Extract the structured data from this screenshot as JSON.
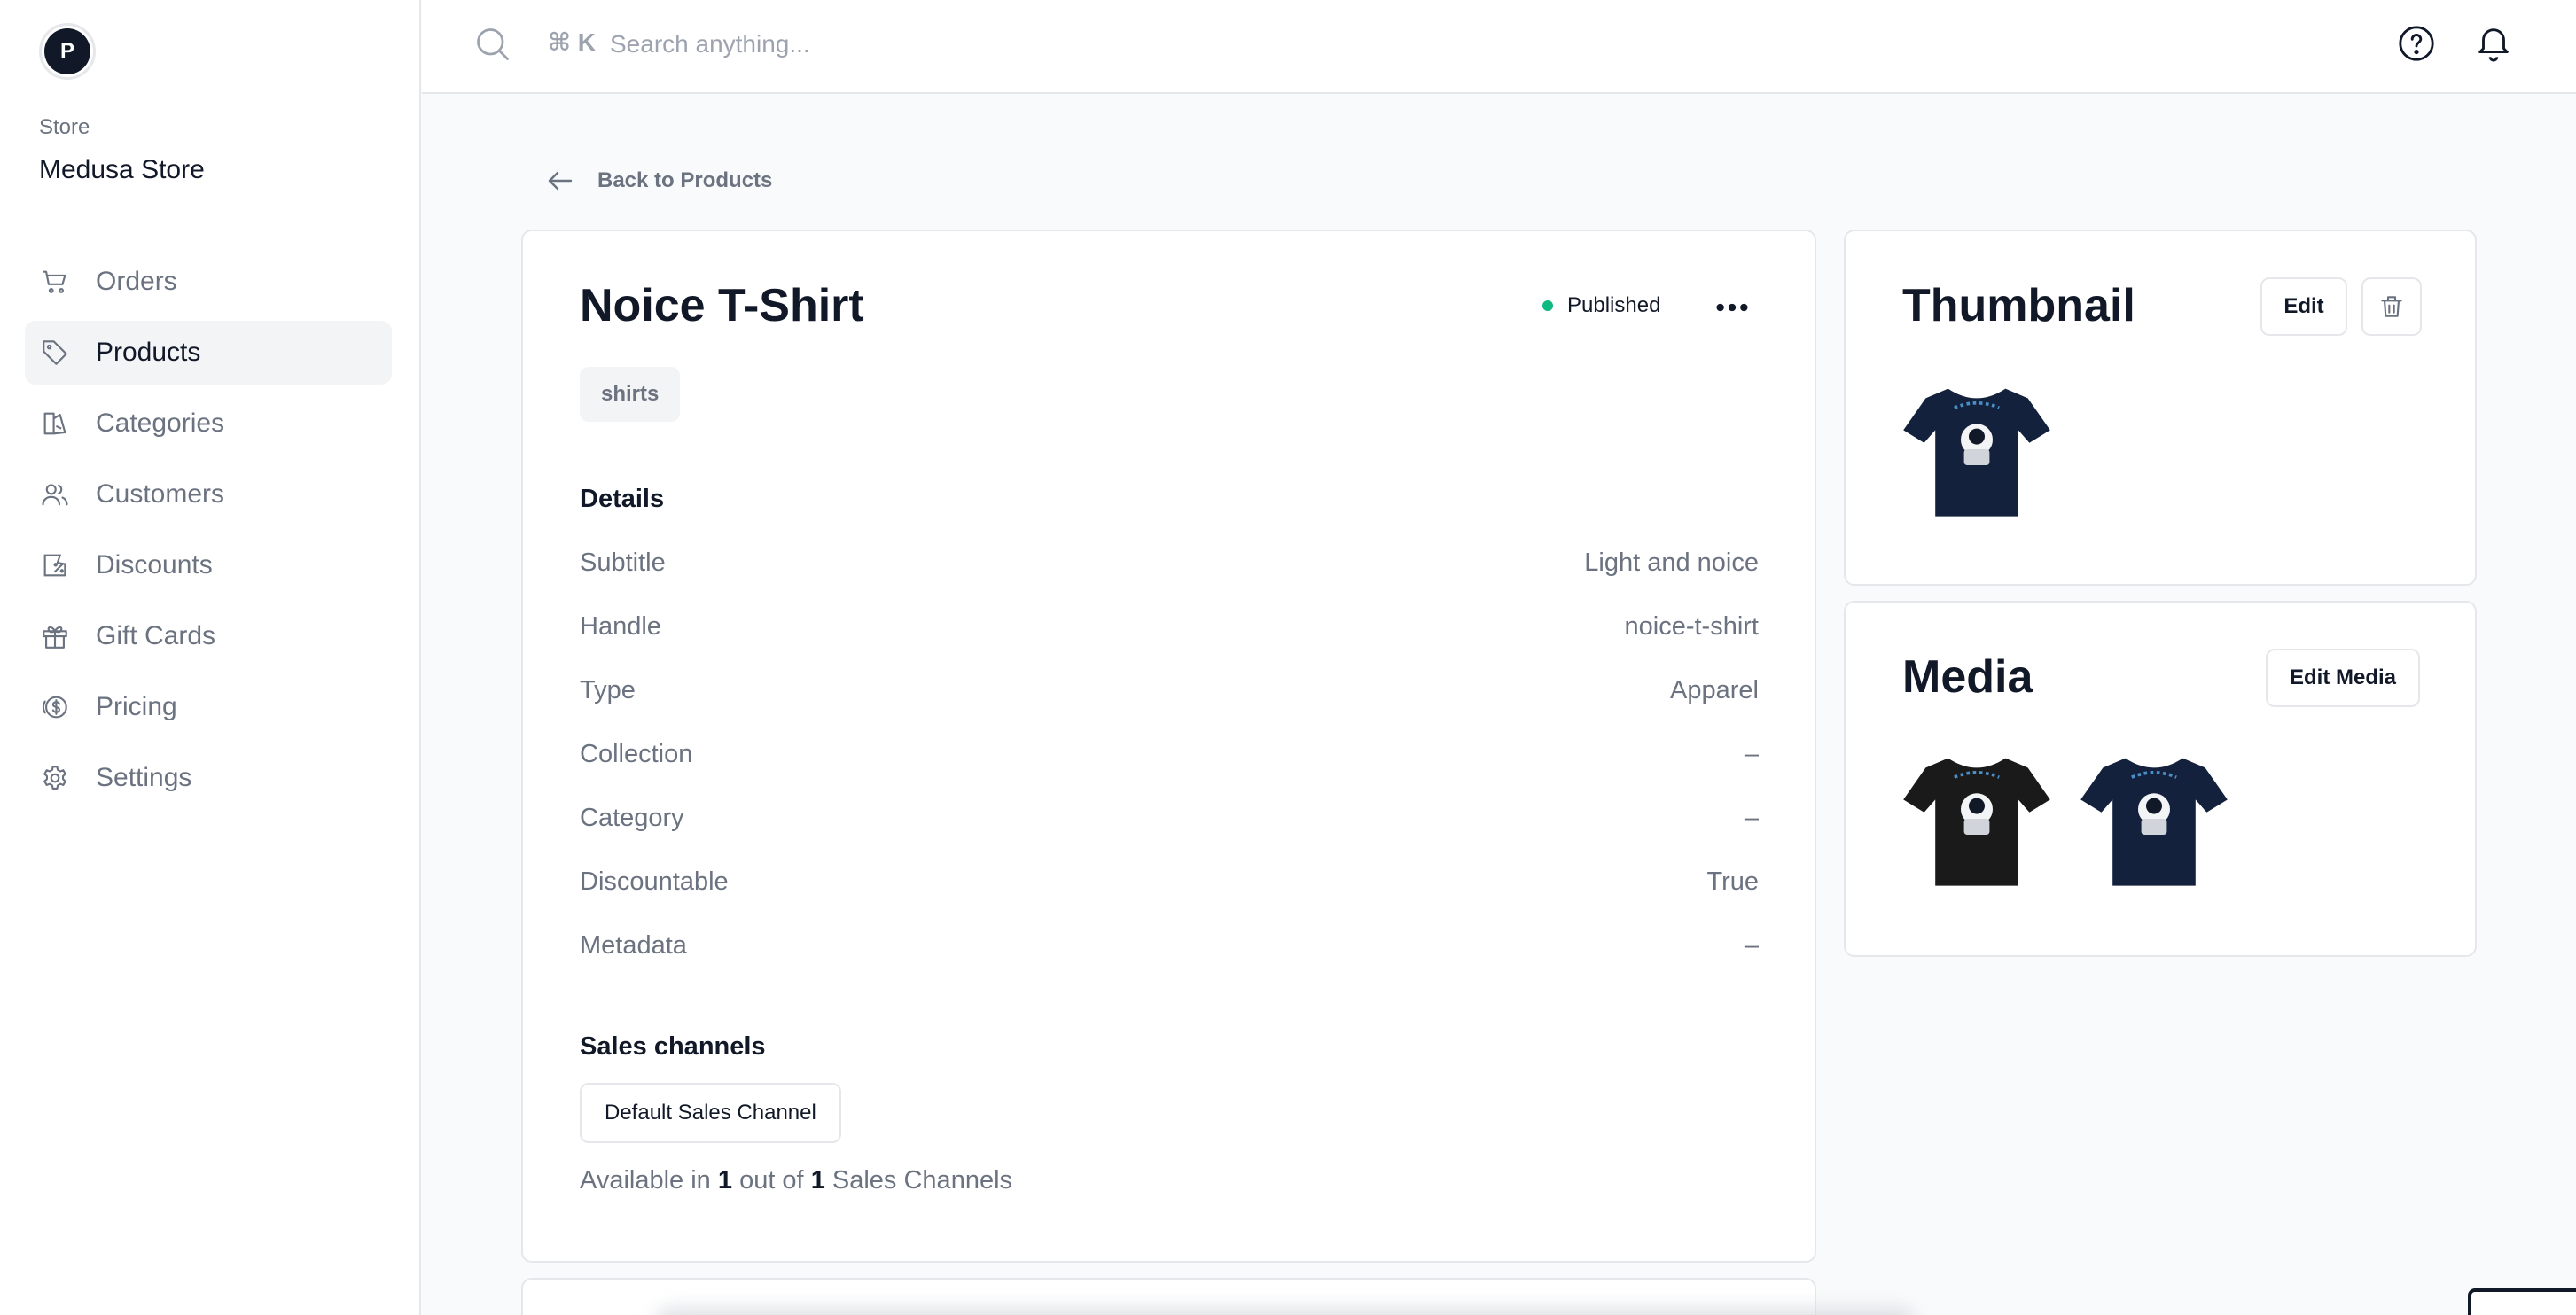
{
  "store": {
    "avatar_letter": "P",
    "label": "Store",
    "name": "Medusa Store"
  },
  "sidebar": {
    "items": [
      {
        "label": "Orders",
        "icon": "cart-icon",
        "active": false
      },
      {
        "label": "Products",
        "icon": "tag-icon",
        "active": true
      },
      {
        "label": "Categories",
        "icon": "categories-icon",
        "active": false
      },
      {
        "label": "Customers",
        "icon": "users-icon",
        "active": false
      },
      {
        "label": "Discounts",
        "icon": "discount-icon",
        "active": false
      },
      {
        "label": "Gift Cards",
        "icon": "gift-icon",
        "active": false
      },
      {
        "label": "Pricing",
        "icon": "dollar-icon",
        "active": false
      },
      {
        "label": "Settings",
        "icon": "gear-icon",
        "active": false
      }
    ]
  },
  "header": {
    "shortcut": "⌘ K",
    "search_placeholder": "Search anything..."
  },
  "back_link": "Back to Products",
  "product": {
    "title": "Noice T-Shirt",
    "status": "Published",
    "tag": "shirts",
    "details_title": "Details",
    "details": [
      {
        "label": "Subtitle",
        "value": "Light and noice"
      },
      {
        "label": "Handle",
        "value": "noice-t-shirt"
      },
      {
        "label": "Type",
        "value": "Apparel"
      },
      {
        "label": "Collection",
        "value": "–"
      },
      {
        "label": "Category",
        "value": "–"
      },
      {
        "label": "Discountable",
        "value": "True"
      },
      {
        "label": "Metadata",
        "value": "–"
      }
    ],
    "sales_channels_title": "Sales channels",
    "sales_channel": "Default Sales Channel",
    "availability": {
      "prefix": "Available in",
      "count": "1",
      "middle": "out of",
      "total": "1",
      "suffix": "Sales Channels"
    }
  },
  "thumbnail": {
    "title": "Thumbnail",
    "edit_label": "Edit"
  },
  "media": {
    "title": "Media",
    "edit_label": "Edit Media"
  },
  "colors": {
    "accent_text": "#111827",
    "muted_text": "#6b7280",
    "status_green": "#10b981",
    "shirt_navy": "#14213d",
    "shirt_black": "#1a1a1a"
  }
}
